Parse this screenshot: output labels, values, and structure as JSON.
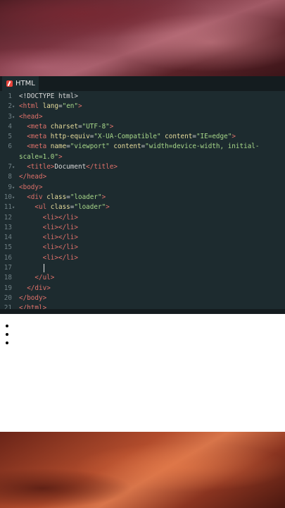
{
  "editor": {
    "tab_label": "HTML",
    "lines": [
      {
        "n": "1",
        "fold": "",
        "segs": [
          {
            "c": "plain",
            "t": "<!DOCTYPE html>"
          }
        ]
      },
      {
        "n": "2",
        "fold": "▾",
        "segs": [
          {
            "c": "tag",
            "t": "<html "
          },
          {
            "c": "attr",
            "t": "lang"
          },
          {
            "c": "plain",
            "t": "="
          },
          {
            "c": "str",
            "t": "\"en\""
          },
          {
            "c": "tag",
            "t": ">"
          }
        ]
      },
      {
        "n": "3",
        "fold": "▾",
        "segs": [
          {
            "c": "tag",
            "t": "<head>"
          }
        ]
      },
      {
        "n": "4",
        "fold": "",
        "segs": [
          {
            "c": "plain",
            "t": "  "
          },
          {
            "c": "tag",
            "t": "<meta "
          },
          {
            "c": "attr",
            "t": "charset"
          },
          {
            "c": "plain",
            "t": "="
          },
          {
            "c": "str",
            "t": "\"UTF-8\""
          },
          {
            "c": "tag",
            "t": ">"
          }
        ]
      },
      {
        "n": "5",
        "fold": "",
        "segs": [
          {
            "c": "plain",
            "t": "  "
          },
          {
            "c": "tag",
            "t": "<meta "
          },
          {
            "c": "attr",
            "t": "http-equiv"
          },
          {
            "c": "plain",
            "t": "="
          },
          {
            "c": "str",
            "t": "\"X-UA-Compatible\""
          },
          {
            "c": "attr",
            "t": " content"
          },
          {
            "c": "plain",
            "t": "="
          },
          {
            "c": "str",
            "t": "\"IE=edge\""
          },
          {
            "c": "tag",
            "t": ">"
          }
        ]
      },
      {
        "n": "6",
        "fold": "",
        "segs": [
          {
            "c": "plain",
            "t": "  "
          },
          {
            "c": "tag",
            "t": "<meta "
          },
          {
            "c": "attr",
            "t": "name"
          },
          {
            "c": "plain",
            "t": "="
          },
          {
            "c": "str",
            "t": "\"viewport\""
          },
          {
            "c": "attr",
            "t": " content"
          },
          {
            "c": "plain",
            "t": "="
          },
          {
            "c": "str",
            "t": "\"width=device-width, initial-"
          }
        ]
      },
      {
        "n": "",
        "fold": "",
        "segs": [
          {
            "c": "str",
            "t": "scale=1.0\""
          },
          {
            "c": "tag",
            "t": ">"
          }
        ]
      },
      {
        "n": "7",
        "fold": "▾",
        "segs": [
          {
            "c": "plain",
            "t": "  "
          },
          {
            "c": "tag",
            "t": "<title>"
          },
          {
            "c": "plain",
            "t": "Document"
          },
          {
            "c": "tag",
            "t": "</title>"
          }
        ]
      },
      {
        "n": "8",
        "fold": "",
        "segs": [
          {
            "c": "tag",
            "t": "</head>"
          }
        ]
      },
      {
        "n": "9",
        "fold": "▾",
        "segs": [
          {
            "c": "tag",
            "t": "<body>"
          }
        ]
      },
      {
        "n": "10",
        "fold": "▾",
        "segs": [
          {
            "c": "plain",
            "t": "  "
          },
          {
            "c": "tag",
            "t": "<div "
          },
          {
            "c": "attr",
            "t": "class"
          },
          {
            "c": "plain",
            "t": "="
          },
          {
            "c": "str",
            "t": "\"loader\""
          },
          {
            "c": "tag",
            "t": ">"
          }
        ]
      },
      {
        "n": "11",
        "fold": "▾",
        "segs": [
          {
            "c": "plain",
            "t": "    "
          },
          {
            "c": "tag",
            "t": "<ul "
          },
          {
            "c": "attr",
            "t": "class"
          },
          {
            "c": "plain",
            "t": "="
          },
          {
            "c": "str",
            "t": "\"loader\""
          },
          {
            "c": "tag",
            "t": ">"
          }
        ]
      },
      {
        "n": "12",
        "fold": "",
        "segs": [
          {
            "c": "plain",
            "t": "      "
          },
          {
            "c": "tag",
            "t": "<li></li>"
          }
        ]
      },
      {
        "n": "13",
        "fold": "",
        "segs": [
          {
            "c": "plain",
            "t": "      "
          },
          {
            "c": "tag",
            "t": "<li></li>"
          }
        ]
      },
      {
        "n": "14",
        "fold": "",
        "segs": [
          {
            "c": "plain",
            "t": "      "
          },
          {
            "c": "tag",
            "t": "<li></li>"
          }
        ]
      },
      {
        "n": "15",
        "fold": "",
        "segs": [
          {
            "c": "plain",
            "t": "      "
          },
          {
            "c": "tag",
            "t": "<li></li>"
          }
        ]
      },
      {
        "n": "16",
        "fold": "",
        "segs": [
          {
            "c": "plain",
            "t": "      "
          },
          {
            "c": "tag",
            "t": "<li></li>"
          }
        ]
      },
      {
        "n": "17",
        "fold": "",
        "segs": [],
        "cursor": true
      },
      {
        "n": "18",
        "fold": "",
        "segs": [
          {
            "c": "plain",
            "t": "    "
          },
          {
            "c": "tag",
            "t": "</ul>"
          }
        ]
      },
      {
        "n": "19",
        "fold": "",
        "segs": [
          {
            "c": "plain",
            "t": "  "
          },
          {
            "c": "tag",
            "t": "</div>"
          }
        ]
      },
      {
        "n": "20",
        "fold": "",
        "segs": [
          {
            "c": "tag",
            "t": "</body>"
          }
        ]
      },
      {
        "n": "21",
        "fold": "",
        "segs": [
          {
            "c": "tag",
            "t": "</html>"
          }
        ]
      }
    ]
  },
  "preview": {
    "bullet_count": 3
  },
  "colors": {
    "tag": "#e0716a",
    "attr": "#e6dc9c",
    "string": "#a8d88a",
    "editor_bg": "#1d2b2f"
  }
}
